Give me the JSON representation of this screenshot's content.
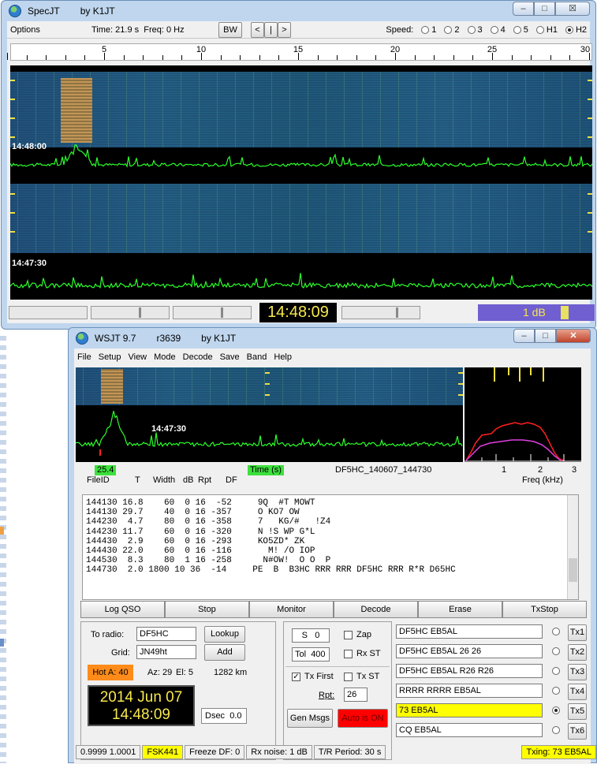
{
  "specjt": {
    "title": "SpecJT",
    "author": "by K1JT",
    "win_buttons": {
      "min": "–",
      "max": "□",
      "close": "☒"
    },
    "options_label": "Options",
    "time_label": "Time: 21.9 s",
    "freq_label": "Freq: 0 Hz",
    "bw_label": "BW",
    "nav": [
      "<",
      "|",
      ">"
    ],
    "speed_label": "Speed:",
    "speeds": [
      "1",
      "2",
      "3",
      "4",
      "5",
      "H1",
      "H2"
    ],
    "speed_selected": "H2",
    "scale_labels": [
      "5",
      "10",
      "15",
      "20",
      "25",
      "30"
    ],
    "time_marks": [
      "14:48:00",
      "14:47:30"
    ],
    "clock": "14:48:09",
    "db_label": "1 dB"
  },
  "wsjt": {
    "title": "WSJT 9.7",
    "rev": "r3639",
    "author": "by K1JT",
    "menu": [
      "File",
      "Setup",
      "View",
      "Mode",
      "Decode",
      "Save",
      "Band",
      "Help"
    ],
    "graph_time": "14:47:30",
    "tag_df": "25.4",
    "tag_time": "Time (s)",
    "filename": "DF5HC_140607_144730",
    "freq_ticks": [
      "1",
      "2",
      "3"
    ],
    "freq_label": "Freq (kHz)",
    "col_headers": {
      "fileid": "FileID",
      "t": "T",
      "width": "Width",
      "db": "dB",
      "rpt": "Rpt",
      "df": "DF"
    },
    "decodes": [
      "144130 16.8    60  0 16  -52     9Q  #T MOWT",
      "144130 29.7    40  0 16 -357     O KO7 OW",
      "144230  4.7    80  0 16 -358     7   KG/#   !Z4",
      "144230 11.7    60  0 16 -320     N !S WP G*L",
      "144430  2.9    60  0 16 -293     KO5ZD* ZK",
      "144430 22.0    60  0 16 -116       M! /O IOP",
      "144530  8.3    80  1 16 -258      N#OW!  O O  P",
      "144730  2.0 1800 10 36  -14     PE  B  B3HC RRR RRR DF5HC RRR R*R D65HC"
    ],
    "buttons": [
      "Log QSO",
      "Stop",
      "Monitor",
      "Decode",
      "Erase",
      "TxStop"
    ],
    "to_radio_label": "To radio:",
    "to_radio_value": "DF5HC",
    "lookup_label": "Lookup",
    "grid_label": "Grid:",
    "grid_value": "JN49ht",
    "add_label": "Add",
    "hot_a": "Hot A: 40",
    "az": "Az: 29",
    "el": "El: 5",
    "dist": "1282 km",
    "date": "2014 Jun 07",
    "time": "14:48:09",
    "dsec_label": "Dsec",
    "dsec_value": "0.0",
    "s_label": "S",
    "s_value": "0",
    "tol_label": "Tol",
    "tol_value": "400",
    "zap_label": "Zap",
    "rxst_label": "Rx ST",
    "txfirst_label": "Tx First",
    "txst_label": "Tx ST",
    "rpt_label": "Rpt:",
    "rpt_value": "26",
    "genmsgs_label": "Gen Msgs",
    "auto_label": "Auto is ON",
    "messages": [
      {
        "text": "DF5HC EB5AL",
        "btn": "Tx1",
        "selected": false
      },
      {
        "text": "DF5HC EB5AL 26 26",
        "btn": "Tx2",
        "selected": false
      },
      {
        "text": "DF5HC EB5AL R26 R26",
        "btn": "Tx3",
        "selected": false
      },
      {
        "text": "RRRR RRRR EB5AL",
        "btn": "Tx4",
        "selected": false
      },
      {
        "text": "73 EB5AL",
        "btn": "Tx5",
        "selected": true
      },
      {
        "text": "CQ EB5AL",
        "btn": "Tx6",
        "selected": false
      }
    ],
    "status": {
      "ratio": "0.9999 1.0001",
      "mode": "FSK441",
      "freeze": "Freeze DF:   0",
      "rxnoise": "Rx noise:  1 dB",
      "trperiod": "T/R Period: 30 s",
      "txing": "Txing:  73 EB5AL"
    },
    "colors": {
      "yellow": "#ffff00",
      "auto_red": "#ff0000",
      "hot_orange": "#ff8c1a",
      "green": "#3de03d",
      "trace": "#2bff2b"
    }
  }
}
